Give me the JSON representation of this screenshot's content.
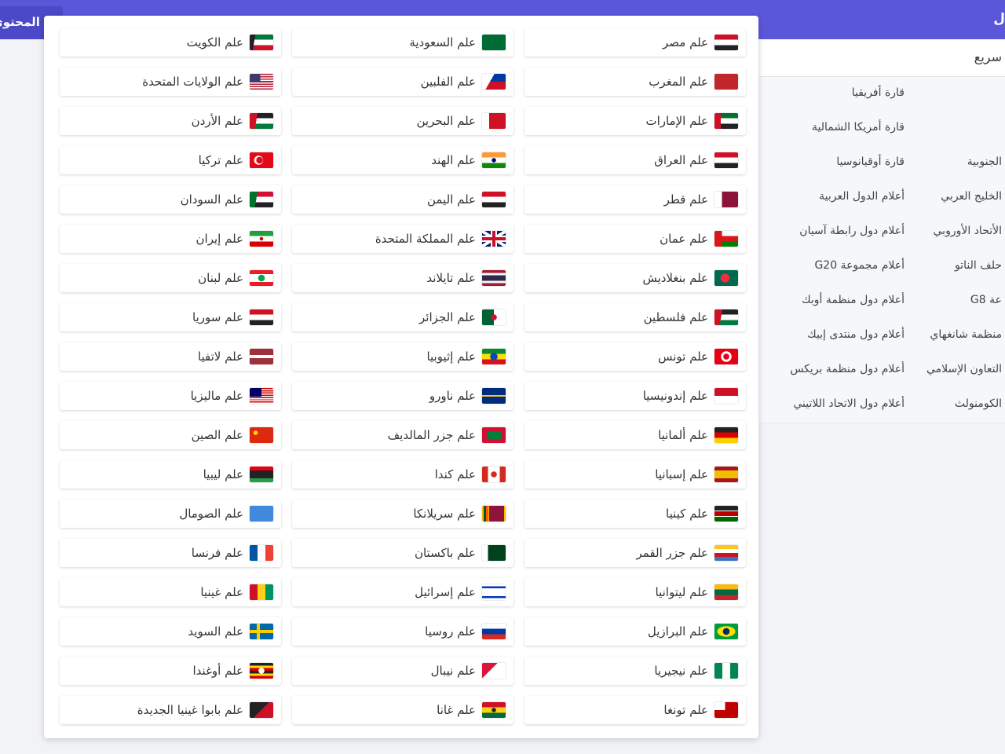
{
  "topbar": {
    "menu_label": "قائمة المحتوى",
    "right_char": "ل"
  },
  "side": {
    "quick_label": "سريع",
    "rows": [
      {
        "c1": "قارة أفريقيا",
        "c2": ""
      },
      {
        "c1": "قارة أمريكا الشمالية",
        "c2": ""
      },
      {
        "c1": "قارة أوقيانوسيا",
        "c2": "الجنوبية"
      },
      {
        "c1": "أعلام الدول العربية",
        "c2": "الخليج العربي"
      },
      {
        "c1": "أعلام دول رابطة آسيان",
        "c2": "الأتحاد الأوروبي"
      },
      {
        "c1": "أعلام مجموعة G20",
        "c2": "حلف الناتو"
      },
      {
        "c1": "أعلام دول منظمة أوبك",
        "c2": "عة G8"
      },
      {
        "c1": "أعلام دول منتدى إبيك",
        "c2": "منظمة شانغهاي"
      },
      {
        "c1": "أعلام دول منظمة بريكس",
        "c2": "التعاون الإسلامي"
      },
      {
        "c1": "أعلام دول الاتحاد اللاتيني",
        "c2": "الكومنولث"
      }
    ]
  },
  "flags": [
    {
      "label": "علم مصر",
      "icon": "egypt-flag-icon",
      "bg": "linear-gradient(#ce1126 0 33.3%,#ffffff 33.3% 66.6%,#222 66.6%)"
    },
    {
      "label": "علم السعودية",
      "icon": "saudi-flag-icon",
      "bg": "#006c35"
    },
    {
      "label": "علم الكويت",
      "icon": "kuwait-flag-icon",
      "bg": "linear-gradient(100deg,#222 0 22%,transparent 22%),linear-gradient(#007a3d 0 33.3%,#ffffff 33.3% 66.6%,#ce1126 66.6%)"
    },
    {
      "label": "علم المغرب",
      "icon": "morocco-flag-icon",
      "bg": "#c1272d"
    },
    {
      "label": "علم الفلبين",
      "icon": "philippines-flag-icon",
      "bg": "linear-gradient(120deg,#ffffff 0 38%,transparent 38%),linear-gradient(#0038a8 0 50%,#ce1126 50%)"
    },
    {
      "label": "علم الولايات المتحدة",
      "icon": "usa-flag-icon",
      "bg": "linear-gradient(#3c3b6e,#3c3b6e) 0 0/45% 54% no-repeat,repeating-linear-gradient(#b22234 0 1.54px,#ffffff 1.54px 3.08px)"
    },
    {
      "label": "علم الإمارات",
      "icon": "uae-flag-icon",
      "bg": "linear-gradient(90deg,#ce1126 0 26%,transparent 26%),linear-gradient(#00732f 0 33.3%,#ffffff 33.3% 66.6%,#222 66.6%)"
    },
    {
      "label": "علم البحرين",
      "icon": "bahrain-flag-icon",
      "bg": "linear-gradient(90deg,#ffffff 0 30%,#ce1126 30%)"
    },
    {
      "label": "علم الأردن",
      "icon": "jordan-flag-icon",
      "bg": "linear-gradient(100deg,#ce1126 0 30%,transparent 30%),linear-gradient(#222 0 33.3%,#ffffff 33.3% 66.6%,#007a3d 66.6%)"
    },
    {
      "label": "علم العراق",
      "icon": "iraq-flag-icon",
      "bg": "linear-gradient(#ce1126 0 33.3%,#ffffff 33.3% 66.6%,#222 66.6%)"
    },
    {
      "label": "علم الهند",
      "icon": "india-flag-icon",
      "bg": "radial-gradient(circle,#000080 0 2.5px,transparent 3px),linear-gradient(#ff9933 0 33.3%,#ffffff 33.3% 66.6%,#138808 66.6%)"
    },
    {
      "label": "علم تركيا",
      "icon": "turkey-flag-icon",
      "bg": "radial-gradient(circle at 42% 50%,#e30a17 0 4px,transparent 4.5px),radial-gradient(circle at 38% 50%,#ffffff 0 5.5px,transparent 6px),#e30a17"
    },
    {
      "label": "علم قطر",
      "icon": "qatar-flag-icon",
      "bg": "linear-gradient(90deg,#ffffff 0 32%,#8a1538 32%)"
    },
    {
      "label": "علم اليمن",
      "icon": "yemen-flag-icon",
      "bg": "linear-gradient(#ce1126 0 33.3%,#ffffff 33.3% 66.6%,#222 66.6%)"
    },
    {
      "label": "علم السودان",
      "icon": "sudan-flag-icon",
      "bg": "linear-gradient(100deg,#007229 0 30%,transparent 30%),linear-gradient(#d21034 0 33.3%,#ffffff 33.3% 66.6%,#222 66.6%)"
    },
    {
      "label": "علم عمان",
      "icon": "oman-flag-icon",
      "bg": "linear-gradient(90deg,#db161b 0 32%,transparent 32%),linear-gradient(#ffffff 0 33.3%,#db161b 33.3% 66.6%,#008000 66.6%)"
    },
    {
      "label": "علم المملكة المتحدة",
      "icon": "uk-flag-icon",
      "bg": "linear-gradient(#c8102e,#c8102e) center/100% 4px no-repeat,linear-gradient(90deg,#c8102e,#c8102e) center/4px 100% no-repeat,linear-gradient(#ffffff,#ffffff) center/100% 8px no-repeat,linear-gradient(90deg,#ffffff,#ffffff) center/8px 100% no-repeat,linear-gradient(33deg,transparent 44%,#ffffff 44% 56%,transparent 56%),linear-gradient(-33deg,transparent 44%,#ffffff 44% 56%,transparent 56%),#012169"
    },
    {
      "label": "علم إيران",
      "icon": "iran-flag-icon",
      "bg": "radial-gradient(circle,#da0000 0 2px,transparent 2.5px),linear-gradient(#239f40 0 33.3%,#ffffff 33.3% 66.6%,#da0000 66.6%)"
    },
    {
      "label": "علم بنغلاديش",
      "icon": "bangladesh-flag-icon",
      "bg": "radial-gradient(circle at 45% 50%,#f42a41 0 5.5px,transparent 6px),#006a4e"
    },
    {
      "label": "علم تايلاند",
      "icon": "thailand-flag-icon",
      "bg": "linear-gradient(#a51931 0 16.6%,#f4f5f8 16.6% 33.3%,#2d2a4a 33.3% 66.6%,#f4f5f8 66.6% 83.3%,#a51931 83.3%)"
    },
    {
      "label": "علم لبنان",
      "icon": "lebanon-flag-icon",
      "bg": "radial-gradient(ellipse 5px 5px at 50% 50%,#00a651 0 4px,transparent 4.5px),linear-gradient(#ed1c24 0 25%,#ffffff 25% 75%,#ed1c24 75%)"
    },
    {
      "label": "علم فلسطين",
      "icon": "palestine-flag-icon",
      "bg": "linear-gradient(100deg,#ce1126 0 30%,transparent 30%),linear-gradient(#222 0 33.3%,#ffffff 33.3% 66.6%,#007a3d 66.6%)"
    },
    {
      "label": "علم الجزائر",
      "icon": "algeria-flag-icon",
      "bg": "radial-gradient(circle at 50% 50%,#d21034 0 3.5px,transparent 4px),linear-gradient(90deg,#006233 0 50%,#ffffff 50%)"
    },
    {
      "label": "علم سوريا",
      "icon": "syria-flag-icon",
      "bg": "linear-gradient(#ce1126 0 33.3%,#ffffff 33.3% 66.6%,#222 66.6%)"
    },
    {
      "label": "علم تونس",
      "icon": "tunisia-flag-icon",
      "bg": "radial-gradient(circle,#e70013 0 3.5px,transparent 4px),radial-gradient(circle,#ffffff 0 6.5px,transparent 7px),#e70013"
    },
    {
      "label": "علم إثيوبيا",
      "icon": "ethiopia-flag-icon",
      "bg": "radial-gradient(circle,#0f47af 0 4.5px,transparent 5px),linear-gradient(#078930 0 33.3%,#fcdd09 33.3% 66.6%,#da121a 66.6%)"
    },
    {
      "label": "علم لاتفيا",
      "icon": "latvia-flag-icon",
      "bg": "linear-gradient(#9e3039 0 40%,#ffffff 40% 60%,#9e3039 60%)"
    },
    {
      "label": "علم إندونيسيا",
      "icon": "indonesia-flag-icon",
      "bg": "linear-gradient(#ce1126 0 50%,#ffffff 50%)"
    },
    {
      "label": "علم ناورو",
      "icon": "nauru-flag-icon",
      "bg": "linear-gradient(#002b7f 0 45%,#ffc61e 45% 55%,#002b7f 55%)"
    },
    {
      "label": "علم ماليزيا",
      "icon": "malaysia-flag-icon",
      "bg": "linear-gradient(#010066,#010066) 0 0/50% 57% no-repeat,repeating-linear-gradient(#cc0001 0 1.43px,#ffffff 1.43px 2.86px)"
    },
    {
      "label": "علم ألمانيا",
      "icon": "germany-flag-icon",
      "bg": "linear-gradient(#222 0 33.3%,#dd0000 33.3% 66.6%,#ffce00 66.6%)"
    },
    {
      "label": "علم جزر المالديف",
      "icon": "maldives-flag-icon",
      "bg": "linear-gradient(#007e3a,#007e3a) center/60% 50% no-repeat,#d21034"
    },
    {
      "label": "علم الصين",
      "icon": "china-flag-icon",
      "bg": "radial-gradient(circle at 25% 35%,#ffde00 0 2.5px,transparent 3px),#de2910"
    },
    {
      "label": "علم إسبانيا",
      "icon": "spain-flag-icon",
      "bg": "linear-gradient(#aa151b 0 25%,#f1bf00 25% 75%,#aa151b 75%)"
    },
    {
      "label": "علم كندا",
      "icon": "canada-flag-icon",
      "bg": "radial-gradient(circle,#d52b1e 0 3.5px,transparent 4px),linear-gradient(90deg,#d52b1e 0 25%,#ffffff 25% 75%,#d52b1e 75%)"
    },
    {
      "label": "علم ليبيا",
      "icon": "libya-flag-icon",
      "bg": "linear-gradient(#e70013 0 25%,#222 25% 75%,#239e46 75%)"
    },
    {
      "label": "علم كينيا",
      "icon": "kenya-flag-icon",
      "bg": "linear-gradient(#222 0 30%,#ffffff 30% 36%,#bb0000 36% 64%,#ffffff 64% 70%,#006600 70%)"
    },
    {
      "label": "علم سريلانكا",
      "icon": "sri-lanka-flag-icon",
      "bg": "linear-gradient(90deg,#ffb700 0 6%,#005641 6% 16%,#ff5b00 16% 26%,#ffb700 26% 30%,#8d153a 30% 94%,#ffb700 94%)"
    },
    {
      "label": "علم الصومال",
      "icon": "somalia-flag-icon",
      "bg": "#4189dd"
    },
    {
      "label": "علم جزر القمر",
      "icon": "comoros-flag-icon",
      "bg": "linear-gradient(100deg,#3a75c4 0 0,transparent 0),linear-gradient(#ffc61e 0 25%,#ffffff 25% 50%,#ce1126 50% 75%,#3a75c4 75%)"
    },
    {
      "label": "علم باكستان",
      "icon": "pakistan-flag-icon",
      "bg": "linear-gradient(90deg,#ffffff 0 25%,#01411c 25%)"
    },
    {
      "label": "علم فرنسا",
      "icon": "france-flag-icon",
      "bg": "linear-gradient(90deg,#0055a4 0 33.3%,#ffffff 33.3% 66.6%,#ef4135 66.6%)"
    },
    {
      "label": "علم ليتوانيا",
      "icon": "lithuania-flag-icon",
      "bg": "linear-gradient(#fdb913 0 33.3%,#006a44 33.3% 66.6%,#c1272d 66.6%)"
    },
    {
      "label": "علم إسرائيل",
      "icon": "israel-flag-icon",
      "bg": "linear-gradient(#ffffff 0 12%,#0038b8 12% 24%,#ffffff 24% 76%,#0038b8 76% 88%,#ffffff 88%)"
    },
    {
      "label": "علم غينيا",
      "icon": "guinea-flag-icon",
      "bg": "linear-gradient(90deg,#ce1126 0 33.3%,#fcd116 33.3% 66.6%,#009460 66.6%)"
    },
    {
      "label": "علم البرازيل",
      "icon": "brazil-flag-icon",
      "bg": "radial-gradient(circle,#002776 0 4px,transparent 4.5px),radial-gradient(ellipse 12px 7px at 50% 50%,#ffdf00 0 11px,transparent 12px),#009c3b"
    },
    {
      "label": "علم روسيا",
      "icon": "russia-flag-icon",
      "bg": "linear-gradient(#ffffff 0 33.3%,#0039a6 33.3% 66.6%,#d52b1e 66.6%)"
    },
    {
      "label": "علم السويد",
      "icon": "sweden-flag-icon",
      "bg": "linear-gradient(#fecc00,#fecc00) center/100% 4px no-repeat,linear-gradient(90deg,transparent 30%,#fecc00 30% 43%,transparent 43%),#006aa7"
    },
    {
      "label": "علم نيجيريا",
      "icon": "nigeria-flag-icon",
      "bg": "linear-gradient(90deg,#008751 0 33.3%,#ffffff 33.3% 66.6%,#008751 66.6%)"
    },
    {
      "label": "علم نيبال",
      "icon": "nepal-flag-icon",
      "bg": "linear-gradient(135deg,#dc143c 0 40%,transparent 40%),#ffffff"
    },
    {
      "label": "علم أوغندا",
      "icon": "uganda-flag-icon",
      "bg": "radial-gradient(circle,#ffffff 0 3.5px,transparent 4px),linear-gradient(#222 0 16.6%,#fcdc04 16.6% 33.3%,#d90000 33.3% 50%,#222 50% 66.6%,#fcdc04 66.6% 83.3%,#d90000 83.3%)"
    },
    {
      "label": "علم تونغا",
      "icon": "tonga-flag-icon",
      "bg": "linear-gradient(#ffffff,#ffffff) 0 0/45% 50% no-repeat,#c10000"
    },
    {
      "label": "علم غانا",
      "icon": "ghana-flag-icon",
      "bg": "radial-gradient(circle,#222 0 2.5px,transparent 3px),linear-gradient(#ce1126 0 33.3%,#fcd116 33.3% 66.6%,#006b3f 66.6%)"
    },
    {
      "label": "علم بابوا غينيا الجديدة",
      "icon": "papua-new-guinea-flag-icon",
      "bg": "linear-gradient(135deg,#222 0 50%,#ce1126 50%)"
    }
  ]
}
